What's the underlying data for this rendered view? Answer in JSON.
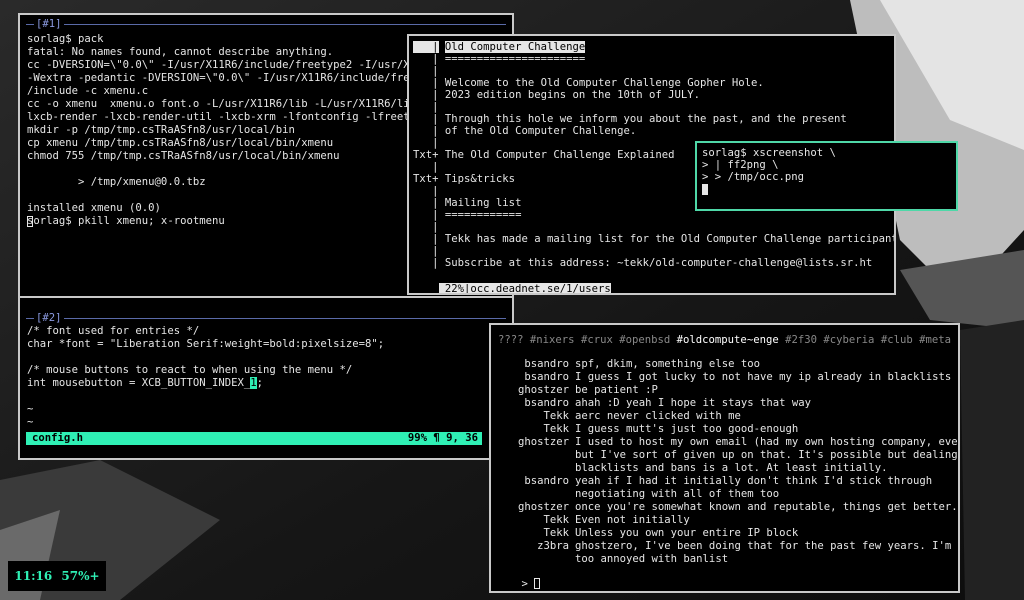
{
  "terminal1": {
    "label": "[#1]",
    "lines": [
      "sorlag$ pack",
      "fatal: No names found, cannot describe anything.",
      "cc -DVERSION=\\\"0.0\\\" -I/usr/X11R6/include/freetype2 -I/usr/X11R",
      "-Wextra -pedantic -DVERSION=\\\"0.0\\\" -I/usr/X11R6/include/freety",
      "/include -c xmenu.c",
      "cc -o xmenu  xmenu.o font.o -L/usr/X11R6/lib -L/usr/X11R6/lib/f",
      "lxcb-render -lxcb-render-util -lxcb-xrm -lfontconfig -lfreetype",
      "mkdir -p /tmp/tmp.csTRaASfn8/usr/local/bin",
      "cp xmenu /tmp/tmp.csTRaASfn8/usr/local/bin/xmenu",
      "chmod 755 /tmp/tmp.csTRaASfn8/usr/local/bin/xmenu",
      "",
      "        > /tmp/xmenu@0.0.tbz",
      "",
      "installed xmenu (0.0)",
      "sorlag$ pkill xmenu; x-rootmenu"
    ]
  },
  "terminal2": {
    "label": "[#2]",
    "lines": [
      "/* font used for entries */",
      "char *font = \"Liberation Serif:weight=bold:pixelsize=8\";",
      "",
      "/* mouse buttons to react to when using the menu */",
      "int mousebutton = XCB_BUTTON_INDEX_",
      "",
      "~",
      "~"
    ],
    "cursor_char": "1",
    "after_cursor": ";",
    "status_file": "config.h",
    "status_pos": "99% ¶ 9, 36"
  },
  "gopher": {
    "lines": [
      {
        "p": "   |",
        "t": "Old Computer Challenge"
      },
      {
        "p": "   |",
        "t": "======================"
      },
      {
        "p": "   |",
        "t": ""
      },
      {
        "p": "   |",
        "t": "Welcome to the Old Computer Challenge Gopher Hole."
      },
      {
        "p": "   |",
        "t": "2023 edition begins on the 10th of JULY."
      },
      {
        "p": "   |",
        "t": ""
      },
      {
        "p": "   |",
        "t": "Through this hole we inform you about the past, and the present"
      },
      {
        "p": "   |",
        "t": "of the Old Computer Challenge."
      },
      {
        "p": "   |",
        "t": ""
      },
      {
        "p": "Txt+",
        "t": "The Old Computer Challenge Explained"
      },
      {
        "p": "   |",
        "t": ""
      },
      {
        "p": "Txt+",
        "t": "Tips&tricks"
      },
      {
        "p": "   |",
        "t": ""
      },
      {
        "p": "   |",
        "t": "Mailing list"
      },
      {
        "p": "   |",
        "t": "============"
      },
      {
        "p": "   |",
        "t": ""
      },
      {
        "p": "   |",
        "t": "Tekk has made a mailing list for the Old Computer Challenge participants."
      },
      {
        "p": "   |",
        "t": ""
      },
      {
        "p": "   |",
        "t": "Subscribe at this address: ~tekk/old-computer-challenge@lists.sr.ht"
      }
    ],
    "status_percent": " 22%|",
    "status_url": "occ.deadnet.se/1/users"
  },
  "screenshot_term": {
    "lines": [
      "sorlag$ xscreenshot \\",
      "> | ff2png \\",
      "> > /tmp/occ.png"
    ]
  },
  "irc": {
    "channels": [
      {
        "name": "????",
        "active": false
      },
      {
        "name": "#nixers",
        "active": false
      },
      {
        "name": "#crux",
        "active": false
      },
      {
        "name": "#openbsd",
        "active": false
      },
      {
        "name": "#oldcompute~enge",
        "active": true
      },
      {
        "name": "#2f30",
        "active": false
      },
      {
        "name": "#cyberia",
        "active": false
      },
      {
        "name": "#club",
        "active": false
      },
      {
        "name": "#meta",
        "active": false
      }
    ],
    "messages": [
      {
        "nick": "bsandro",
        "text": "spf, dkim, something else too"
      },
      {
        "nick": "bsandro",
        "text": "I guess I got lucky to not have my ip already in blacklists"
      },
      {
        "nick": "ghostzer",
        "text": "be patient :P"
      },
      {
        "nick": "bsandro",
        "text": "ahah :D yeah I hope it stays that way"
      },
      {
        "nick": "Tekk",
        "text": "aerc never clicked with me"
      },
      {
        "nick": "Tekk",
        "text": "I guess mutt's just too good-enough"
      },
      {
        "nick": "ghostzer",
        "text": "I used to host my own email (had my own hosting company, even)"
      },
      {
        "nick": "",
        "text": "but I've sort of given up on that. It's possible but dealing with"
      },
      {
        "nick": "",
        "text": "blacklists and bans is a lot. At least initially."
      },
      {
        "nick": "bsandro",
        "text": "yeah if I had it initially don't think I'd stick through"
      },
      {
        "nick": "",
        "text": "negotiating with all of them too"
      },
      {
        "nick": "ghostzer",
        "text": "once you're somewhat known and reputable, things get better."
      },
      {
        "nick": "Tekk",
        "text": "Even not initially"
      },
      {
        "nick": "Tekk",
        "text": "Unless you own your entire IP block"
      },
      {
        "nick": "z3bra",
        "text": "ghostzero, I've been doing that for the past few years. I'm not"
      },
      {
        "nick": "",
        "text": "too annoyed with banlist"
      }
    ],
    "prompt": ">"
  },
  "clock": {
    "time": "11:16",
    "battery": "57%+"
  }
}
